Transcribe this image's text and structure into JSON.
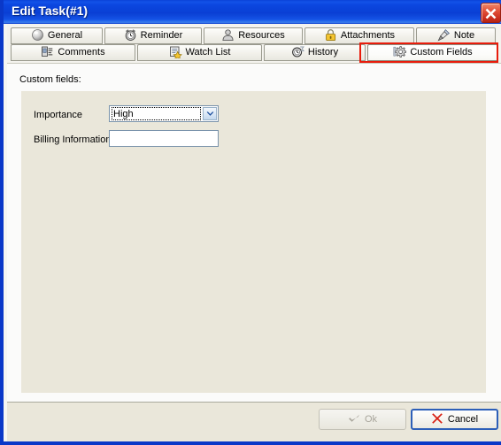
{
  "window": {
    "title": "Edit Task(#1)",
    "close_icon": "close-icon",
    "accent_titlebar": "#0a3fd4",
    "frame_border": "#0a38c8",
    "highlight_color": "#e81c0c"
  },
  "tabs": {
    "row1": [
      {
        "label": "General",
        "icon": "sphere-icon"
      },
      {
        "label": "Reminder",
        "icon": "alarm-clock-icon"
      },
      {
        "label": "Resources",
        "icon": "person-icon"
      },
      {
        "label": "Attachments",
        "icon": "lock-icon"
      },
      {
        "label": "Note",
        "icon": "pushpin-icon"
      }
    ],
    "row2": [
      {
        "label": "Comments",
        "icon": "comment-list-icon"
      },
      {
        "label": "Watch List",
        "icon": "watch-list-icon"
      },
      {
        "label": "History",
        "icon": "history-clock-icon"
      },
      {
        "label": "Custom Fields",
        "icon": "gear-icon",
        "selected": true
      }
    ]
  },
  "main": {
    "section_label": "Custom fields:",
    "fields": [
      {
        "label": "Importance",
        "type": "combobox",
        "value": "High",
        "dropdown_icon": "chevron-down-icon"
      },
      {
        "label": "Billing Information",
        "type": "textbox",
        "value": "",
        "placeholder": ""
      }
    ]
  },
  "footer": {
    "ok": {
      "label": "Ok",
      "icon": "check-icon",
      "enabled": false
    },
    "cancel": {
      "label": "Cancel",
      "icon": "x-icon",
      "enabled": true
    }
  }
}
